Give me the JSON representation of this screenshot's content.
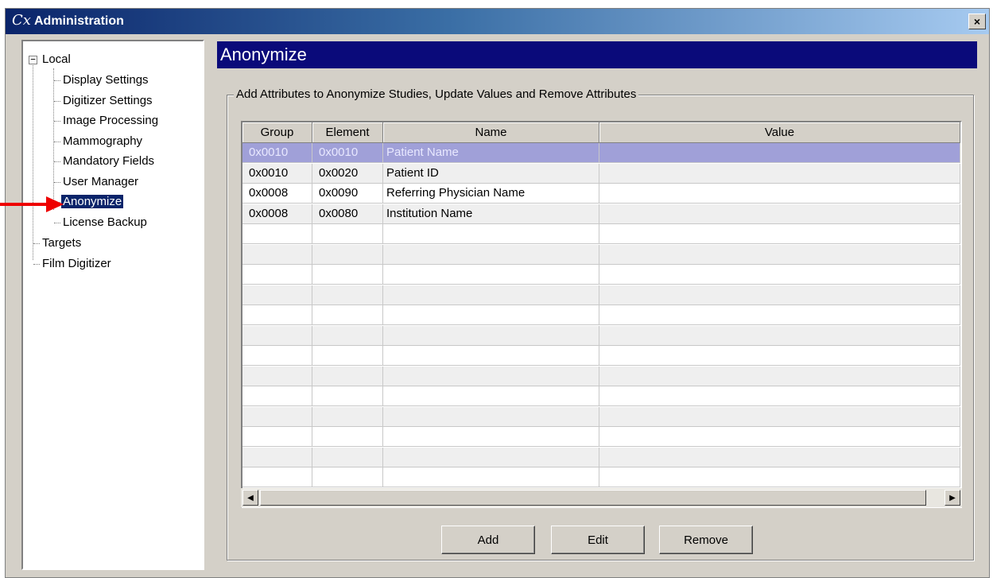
{
  "window": {
    "logo": "Cx",
    "title": "Administration",
    "close_glyph": "×"
  },
  "tree": {
    "root": "Local",
    "expander": "−",
    "children": [
      {
        "label": "Display Settings"
      },
      {
        "label": "Digitizer Settings"
      },
      {
        "label": "Image Processing"
      },
      {
        "label": "Mammography"
      },
      {
        "label": "Mandatory Fields"
      },
      {
        "label": "User Manager"
      },
      {
        "label": "Anonymize",
        "selected": true
      },
      {
        "label": "License Backup"
      }
    ],
    "siblings": [
      {
        "label": "Targets"
      },
      {
        "label": "Film Digitizer"
      }
    ]
  },
  "annotation": {
    "arrow_color": "#ee0000"
  },
  "panel": {
    "title": "Anonymize",
    "group_title": "Add Attributes to Anonymize Studies, Update Values and Remove Attributes"
  },
  "grid": {
    "columns": [
      "Group",
      "Element",
      "Name",
      "Value"
    ],
    "rows": [
      {
        "group": "0x0010",
        "element": "0x0010",
        "name": "Patient Name",
        "value": "",
        "selected": true
      },
      {
        "group": "0x0010",
        "element": "0x0020",
        "name": "Patient ID",
        "value": ""
      },
      {
        "group": "0x0008",
        "element": "0x0090",
        "name": "Referring Physician Name",
        "value": ""
      },
      {
        "group": "0x0008",
        "element": "0x0080",
        "name": "Institution Name",
        "value": ""
      }
    ],
    "empty_rows": 13,
    "scroll_left": "◀",
    "scroll_right": "▶"
  },
  "buttons": {
    "add": "Add",
    "edit": "Edit",
    "remove": "Remove"
  }
}
